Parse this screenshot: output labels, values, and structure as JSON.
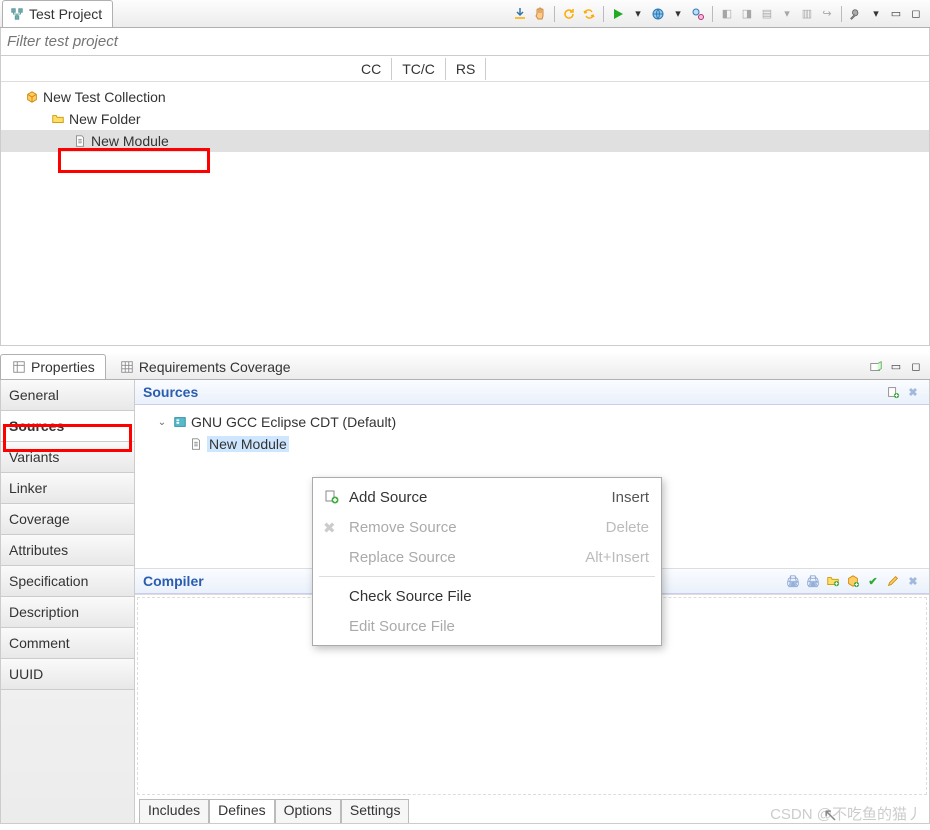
{
  "top_view": {
    "title": "Test Project",
    "filter_placeholder": "Filter test project",
    "columns": [
      "CC",
      "TC/C",
      "RS"
    ],
    "tree": {
      "root": "New Test Collection",
      "folder": "New Folder",
      "module": "New Module"
    }
  },
  "lower_tabs": {
    "properties": "Properties",
    "req_coverage": "Requirements Coverage"
  },
  "sidebar": {
    "items": [
      "General",
      "Sources",
      "Variants",
      "Linker",
      "Coverage",
      "Attributes",
      "Specification",
      "Description",
      "Comment",
      "UUID"
    ],
    "active": "Sources"
  },
  "sources_section": {
    "title": "Sources",
    "tree": {
      "compiler": "GNU GCC Eclipse CDT (Default)",
      "module": "New Module"
    }
  },
  "compiler_section": {
    "title": "Compiler",
    "bottom_tabs": [
      "Includes",
      "Defines",
      "Options",
      "Settings"
    ]
  },
  "context_menu": {
    "items": [
      {
        "label": "Add Source",
        "shortcut": "Insert",
        "enabled": true,
        "icon": "add-icon"
      },
      {
        "label": "Remove Source",
        "shortcut": "Delete",
        "enabled": false,
        "icon": "remove-icon"
      },
      {
        "label": "Replace Source",
        "shortcut": "Alt+Insert",
        "enabled": false,
        "icon": ""
      },
      {
        "sep": true
      },
      {
        "label": "Check Source File",
        "shortcut": "",
        "enabled": true,
        "icon": ""
      },
      {
        "label": "Edit Source File",
        "shortcut": "",
        "enabled": false,
        "icon": ""
      }
    ]
  },
  "watermark": "CSDN @不吃鱼的猫丿"
}
